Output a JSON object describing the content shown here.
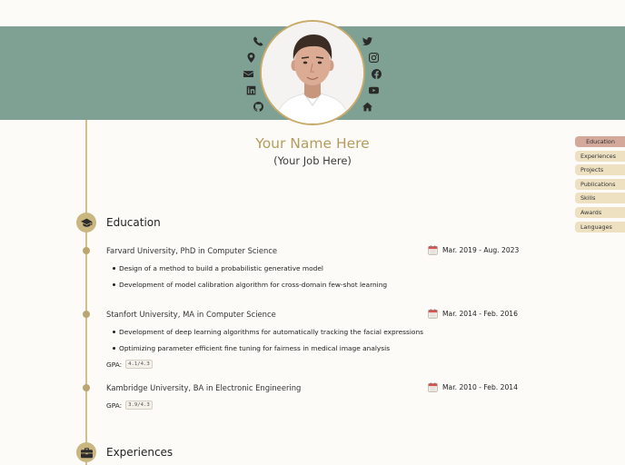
{
  "profile": {
    "name": "Your Name Here",
    "job": "(Your Job Here)"
  },
  "social_icons": [
    "phone-icon",
    "twitter-icon",
    "location-icon",
    "instagram-icon",
    "email-icon",
    "facebook-icon",
    "linkedin-icon",
    "youtube-icon",
    "github-icon",
    "home-icon"
  ],
  "colors": {
    "banner": "#7fa193",
    "accent_gold": "#b59b5e",
    "timeline": "#d4be8e",
    "nav_bg": "#ede1c2",
    "nav_active": "#d4a99c"
  },
  "nav": {
    "items": [
      "Education",
      "Experiences",
      "Projects",
      "Publications",
      "Skills",
      "Awards",
      "Languages"
    ],
    "active": "Education"
  },
  "education": {
    "title": "Education",
    "entries": [
      {
        "title": "Farvard University, PhD in Computer Science",
        "date": "Mar. 2019 - Aug. 2023",
        "bullets": [
          "Design of a method to build a probabilistic generative model",
          "Development of model calibration algorithm for cross-domain few-shot learning"
        ]
      },
      {
        "title": "Stanfort University, MA in Computer Science",
        "date": "Mar. 2014 - Feb. 2016",
        "bullets": [
          "Development of deep learning algorithms for automatically tracking the facial expressions",
          "Optimizing parameter efficient fine tuning for fairness in medical image analysis"
        ],
        "gpa_label": "GPA:",
        "gpa": "4.1/4.3"
      },
      {
        "title": "Kambridge University, BA in Electronic Engineering",
        "date": "Mar. 2010 - Feb. 2014",
        "gpa_label": "GPA:",
        "gpa": "3.9/4.3"
      }
    ]
  },
  "experiences": {
    "title": "Experiences"
  }
}
